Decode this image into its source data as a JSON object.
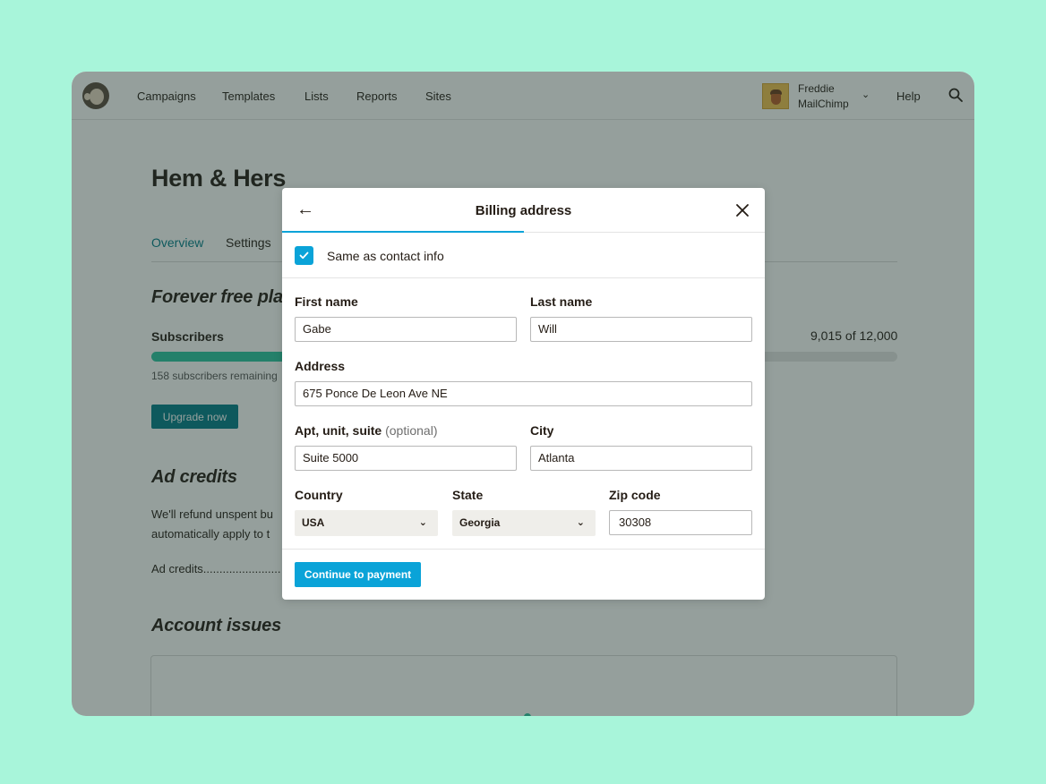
{
  "nav": {
    "items": [
      "Campaigns",
      "Templates",
      "Lists",
      "Reports",
      "Sites"
    ],
    "user_name": "Freddie",
    "user_org": "MailChimp",
    "help": "Help"
  },
  "page": {
    "title": "Hem & Hers",
    "tabs": [
      "Overview",
      "Settings"
    ],
    "plan_heading": "Forever free plan",
    "subscribers_label": "Subscribers",
    "subscribers_count": "9,015 of 12,000",
    "subscribers_fraction": 0.75,
    "subscribers_remaining": "158 subscribers remaining",
    "upgrade_button": "Upgrade now",
    "ad_heading": "Ad credits",
    "ad_text_line1": "We'll refund unspent bu",
    "ad_text_line2": "automatically apply to t",
    "ad_credits_row": "Ad credits........................",
    "issues_heading": "Account issues"
  },
  "modal": {
    "title": "Billing address",
    "step_progress": 0.5,
    "same_as_contact": "Same as contact info",
    "same_as_contact_checked": true,
    "first_name_label": "First name",
    "first_name_value": "Gabe",
    "last_name_label": "Last name",
    "last_name_value": "Will",
    "address_label": "Address",
    "address_value": "675 Ponce De Leon Ave NE",
    "apt_label": "Apt, unit, suite",
    "apt_optional": "(optional)",
    "apt_value": "Suite 5000",
    "city_label": "City",
    "city_value": "Atlanta",
    "country_label": "Country",
    "country_value": "USA",
    "state_label": "State",
    "state_value": "Georgia",
    "zip_label": "Zip code",
    "zip_value": "30308",
    "continue_button": "Continue to payment"
  },
  "colors": {
    "background": "#a8f5da",
    "accent_blue": "#0aa3d8",
    "teal": "#007c89",
    "progress_green": "#2bc4a0"
  },
  "icons": [
    "mailchimp-logo-icon",
    "acorn-avatar-icon",
    "chevron-down-icon",
    "search-icon",
    "back-arrow-icon",
    "close-icon",
    "checkmark-icon"
  ]
}
